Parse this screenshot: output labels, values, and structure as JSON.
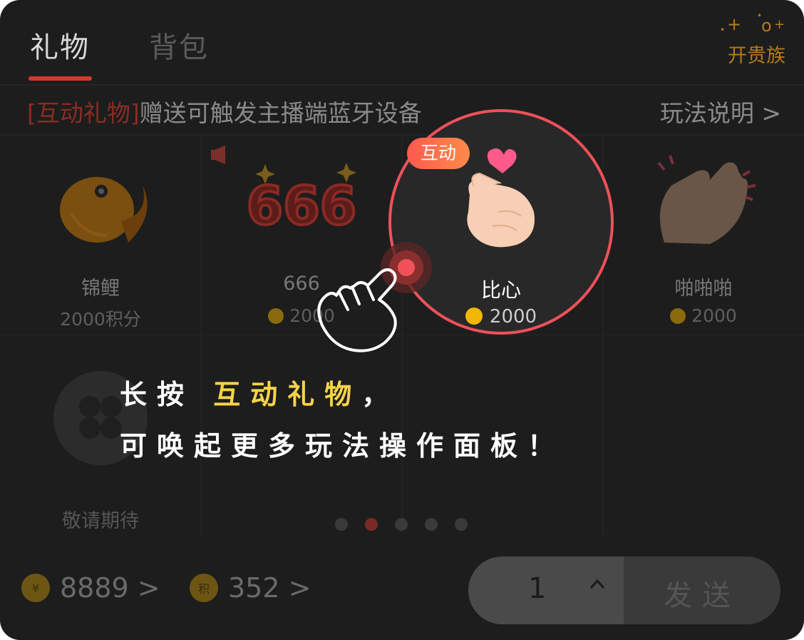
{
  "tabs": [
    {
      "label": "礼物",
      "active": true
    },
    {
      "label": "背包",
      "active": false
    }
  ],
  "vip": {
    "label": "开贵族",
    "icon": "sparkle-icon"
  },
  "banner": {
    "tag": "[互动礼物]",
    "text": "赠送可触发主播端蓝牙设备",
    "link": "玩法说明 >"
  },
  "gifts": [
    {
      "name": "锦鲤",
      "price": "2000积分",
      "icon": "koi-fish-icon"
    },
    {
      "name": "666",
      "price": "2000",
      "icon": "666-icon"
    },
    {
      "name": "比心",
      "price": "2000",
      "icon": "finger-heart-icon",
      "tag": "互动"
    },
    {
      "name": "啪啪啪",
      "price": "2000",
      "icon": "clapping-hands-icon"
    },
    {
      "name": "敬请期待",
      "price": "",
      "icon": "clover-placeholder-icon"
    }
  ],
  "pager": {
    "count": 5,
    "active": 1
  },
  "hint": {
    "line1_prefix": "长按",
    "line1_highlight": "互动礼物",
    "line1_suffix": "，",
    "line2": "可唤起更多玩法操作面板！"
  },
  "footer": {
    "coins": {
      "value": "8889 >",
      "icon_text": "¥"
    },
    "points": {
      "value": "352 >",
      "icon_text": "积"
    },
    "quantity": "1",
    "send_label": "发送"
  },
  "colors": {
    "accent_red": "#f0515a",
    "tab_underline": "#d9372b",
    "gold": "#f2b705",
    "highlight_yellow": "#f7d34a"
  }
}
